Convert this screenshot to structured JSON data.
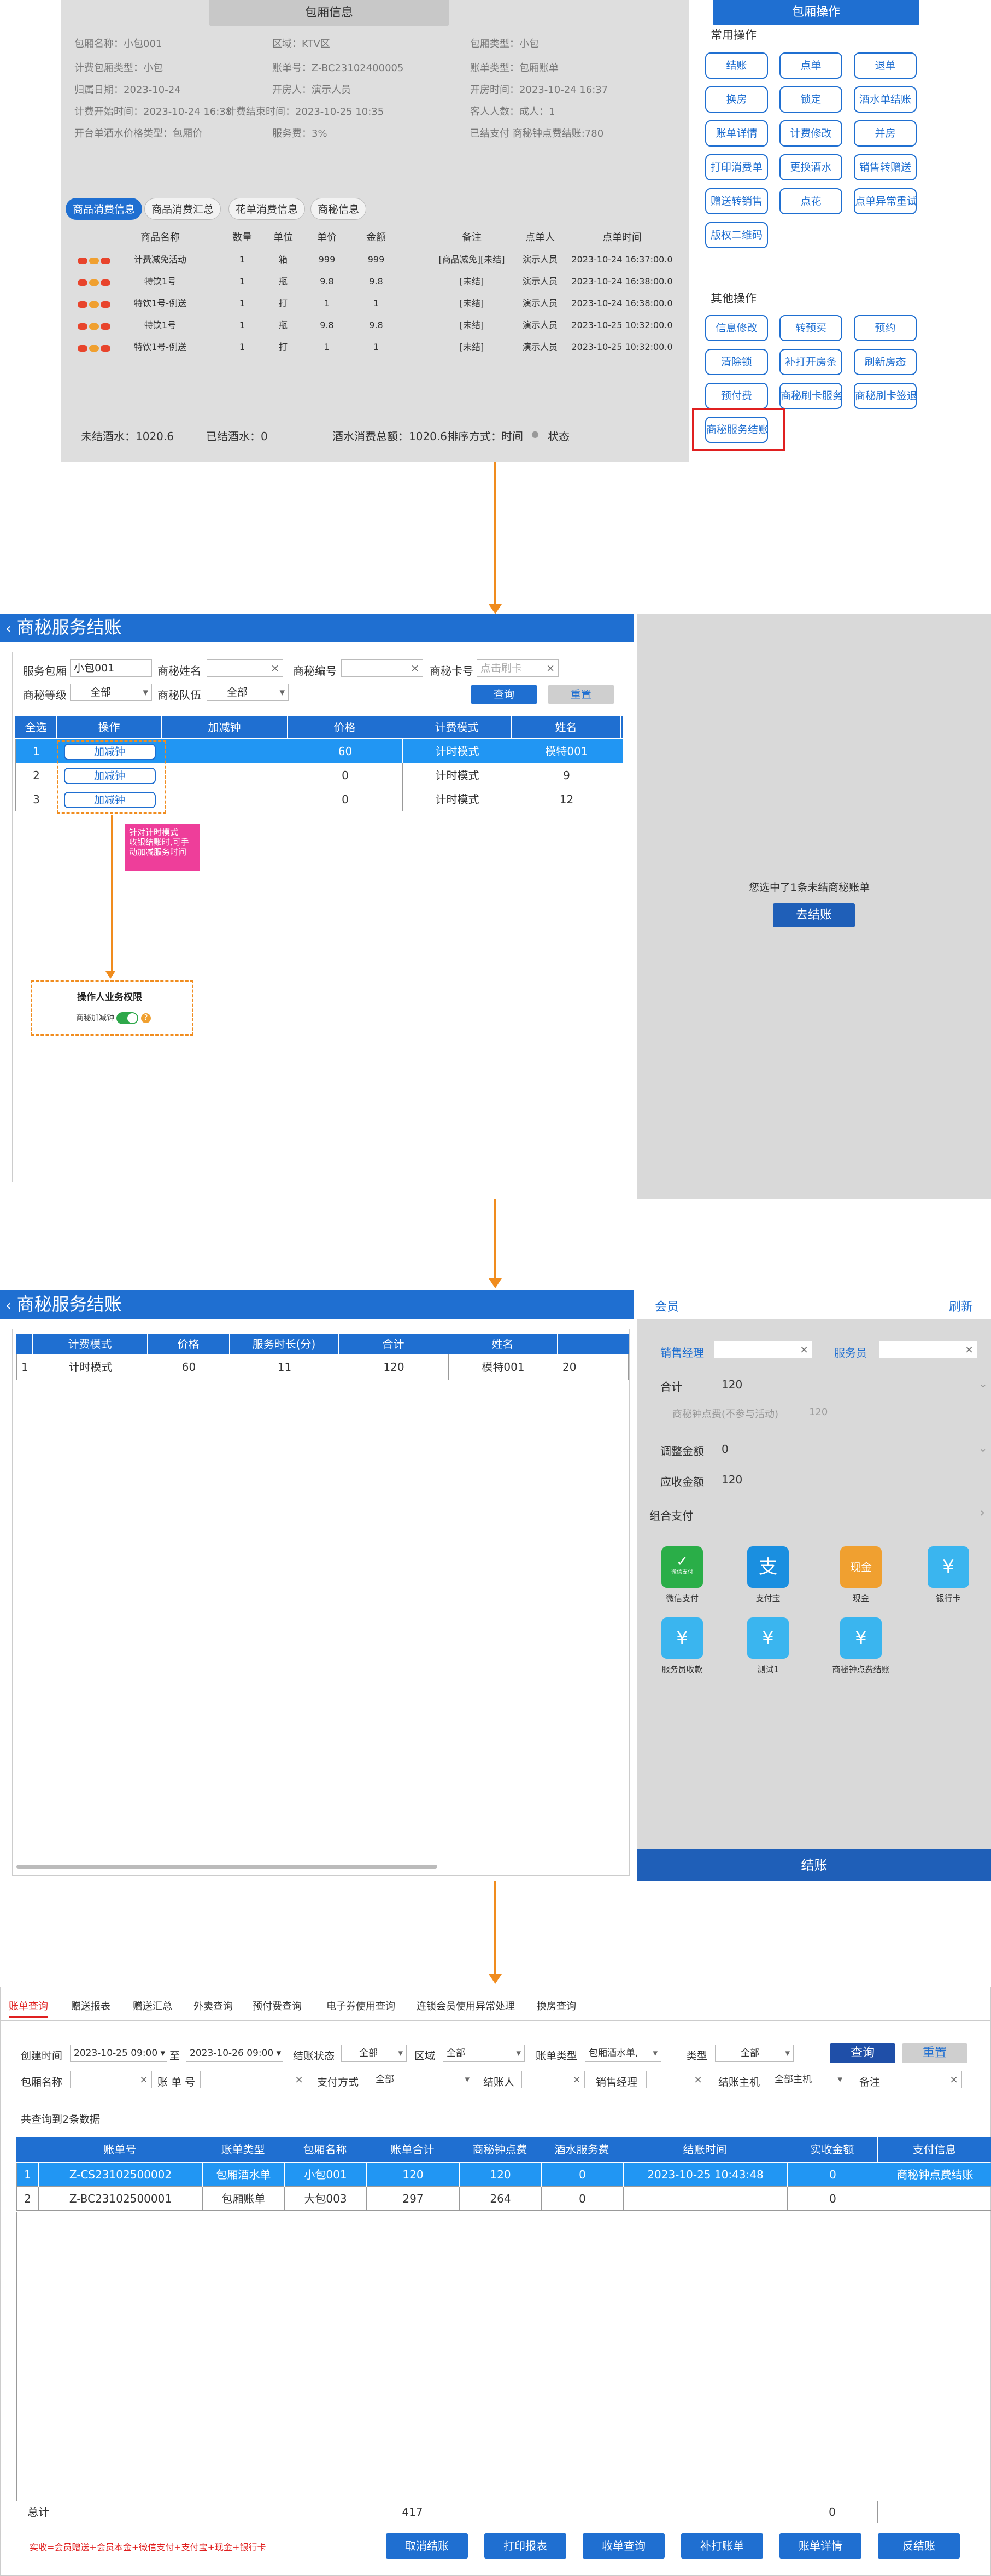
{
  "s1": {
    "title": "包厢信息",
    "info": [
      [
        "包厢名称：小包001",
        "区域：KTV区",
        "包厢类型：小包"
      ],
      [
        "计费包厢类型：小包",
        "账单号：Z-BC23102400005",
        "账单类型：包厢账单"
      ],
      [
        "归属日期：2023-10-24",
        "开房人：演示人员",
        "开房时间：2023-10-24 16:37"
      ],
      [
        "计费开始时间：2023-10-24 16:38",
        "计费结束时间：2023-10-25 10:35",
        "客人人数：成人：1"
      ],
      [
        "开台单酒水价格类型：包厢价",
        "服务费：3%",
        "已结支付 商秘钟点费结账:780"
      ]
    ],
    "tabs": [
      "商品消费信息",
      "商品消费汇总",
      "花单消费信息",
      "商秘信息"
    ],
    "columns": [
      "商品名称",
      "数量",
      "单位",
      "单价",
      "金额",
      "备注",
      "点单人",
      "点单时间"
    ],
    "rows": [
      [
        "计费减免活动",
        "1",
        "箱",
        "999",
        "999",
        "[商品减免][未结]",
        "演示人员",
        "2023-10-24 16:37:00.0"
      ],
      [
        "特饮1号",
        "1",
        "瓶",
        "9.8",
        "9.8",
        "[未结]",
        "演示人员",
        "2023-10-24 16:38:00.0"
      ],
      [
        "特饮1号-例送",
        "1",
        "打",
        "1",
        "1",
        "[未结]",
        "演示人员",
        "2023-10-24 16:38:00.0"
      ],
      [
        "特饮1号",
        "1",
        "瓶",
        "9.8",
        "9.8",
        "[未结]",
        "演示人员",
        "2023-10-25 10:32:00.0"
      ],
      [
        "特饮1号-例送",
        "1",
        "打",
        "1",
        "1",
        "[未结]",
        "演示人员",
        "2023-10-25 10:32:00.0"
      ]
    ],
    "footer": {
      "unsettled": "未结酒水：1020.6",
      "settled": "已结酒水：0",
      "total": "酒水消费总额：1020.6排序方式：",
      "sort_time": "时间",
      "sort_status": "状态"
    },
    "panel_title": "包厢操作",
    "common_label": "常用操作",
    "common_ops": [
      "结账",
      "点单",
      "退单",
      "换房",
      "锁定",
      "酒水单结账",
      "账单详情",
      "计费修改",
      "并房",
      "打印消费单",
      "更换酒水",
      "销售转赠送",
      "赠送转销售",
      "点花",
      "点单异常重试",
      "版权二维码"
    ],
    "other_label": "其他操作",
    "other_ops": [
      "信息修改",
      "转预买",
      "预约",
      "清除锁",
      "补打开房条",
      "刷新房态",
      "预付费",
      "商秘刷卡服务",
      "商秘刷卡签退",
      "商秘服务结账"
    ]
  },
  "s2": {
    "title": "商秘服务结账",
    "f_room": "服务包厢",
    "f_room_val": "小包001",
    "f_name": "商秘姓名",
    "f_code": "商秘编号",
    "f_card": "商秘卡号",
    "f_card_ph": "点击刷卡",
    "f_level": "商秘等级",
    "f_level_val": "全部",
    "f_team": "商秘队伍",
    "f_team_val": "全部",
    "query": "查询",
    "reset": "重置",
    "columns": [
      "全选",
      "操作",
      "加减钟",
      "价格",
      "计费模式",
      "姓名"
    ],
    "rows": [
      {
        "idx": "1",
        "op": "加减钟",
        "price": "60",
        "mode": "计时模式",
        "name": "模特001"
      },
      {
        "idx": "2",
        "op": "加减钟",
        "price": "0",
        "mode": "计时模式",
        "name": "9"
      },
      {
        "idx": "3",
        "op": "加减钟",
        "price": "0",
        "mode": "计时模式",
        "name": "12"
      }
    ],
    "note": "针对计时模式\n收银结账时,可手\n动加减服务时间",
    "perm_title": "操作人业务权限",
    "perm_label": "商秘加减钟",
    "right_text": "您选中了1条未结商秘账单",
    "right_btn": "去结账"
  },
  "s3": {
    "title": "商秘服务结账",
    "columns": [
      "计费模式",
      "价格",
      "服务时长(分)",
      "合计",
      "姓名"
    ],
    "row": [
      "1",
      "计时模式",
      "60",
      "11",
      "120",
      "模特001",
      "20"
    ],
    "member": "会员",
    "refresh": "刷新",
    "sales_mgr": "销售经理",
    "waiter": "服务员",
    "total_label": "合计",
    "total_val": "120",
    "fee_label": "商秘钟点费(不参与活动)",
    "fee_val": "120",
    "adjust_label": "调整金额",
    "adjust_val": "0",
    "due_label": "应收金额",
    "due_val": "120",
    "combo": "组合支付",
    "pays": [
      "微信支付",
      "支付宝",
      "现金",
      "银行卡",
      "服务员收款",
      "测试1",
      "商秘钟点费结账"
    ],
    "wechat_sub": "微信支付",
    "cash_sub": "现金",
    "settle": "结账"
  },
  "s4": {
    "tabs": [
      "账单查询",
      "赠送报表",
      "赠送汇总",
      "外卖查询",
      "预付费查询",
      "电子券使用查询",
      "连锁会员使用异常处理",
      "换房查询"
    ],
    "create_time": "创建时间",
    "date_from": "2023-10-25 09:00",
    "to": "至",
    "date_to": "2023-10-26 09:00",
    "status": "结账状态",
    "status_val": "全部",
    "area": "区域",
    "area_val": "全部",
    "bill_type": "账单类型",
    "bill_type_val": "包厢酒水单,",
    "type": "类型",
    "type_val": "全部",
    "query": "查询",
    "reset": "重置",
    "room_name": "包厢名称",
    "bill_no": "账 单 号",
    "pay_method": "支付方式",
    "pay_method_val": "全部",
    "settler": "结账人",
    "sales_mgr": "销售经理",
    "host": "结账主机",
    "host_val": "全部主机",
    "remark": "备注",
    "count": "共查询到2条数据",
    "columns": [
      "账单号",
      "账单类型",
      "包厢名称",
      "账单合计",
      "商秘钟点费",
      "酒水服务费",
      "结账时间",
      "实收金额",
      "支付信息"
    ],
    "rows": [
      [
        "1",
        "Z-CS23102500002",
        "包厢酒水单",
        "小包001",
        "120",
        "120",
        "0",
        "2023-10-25 10:43:48",
        "0",
        "商秘钟点费结账"
      ],
      [
        "2",
        "Z-BC23102500001",
        "包厢账单",
        "大包003",
        "297",
        "264",
        "0",
        "",
        "0",
        ""
      ]
    ],
    "sum_label": "总计",
    "sum_total": "417",
    "sum_actual": "0",
    "pay_summary": "实收=会员赠送+会员本金+微信支付+支付宝+现金+银行卡",
    "buttons": [
      "取消结账",
      "打印报表",
      "收单查询",
      "补打账单",
      "账单详情",
      "反结账"
    ]
  }
}
